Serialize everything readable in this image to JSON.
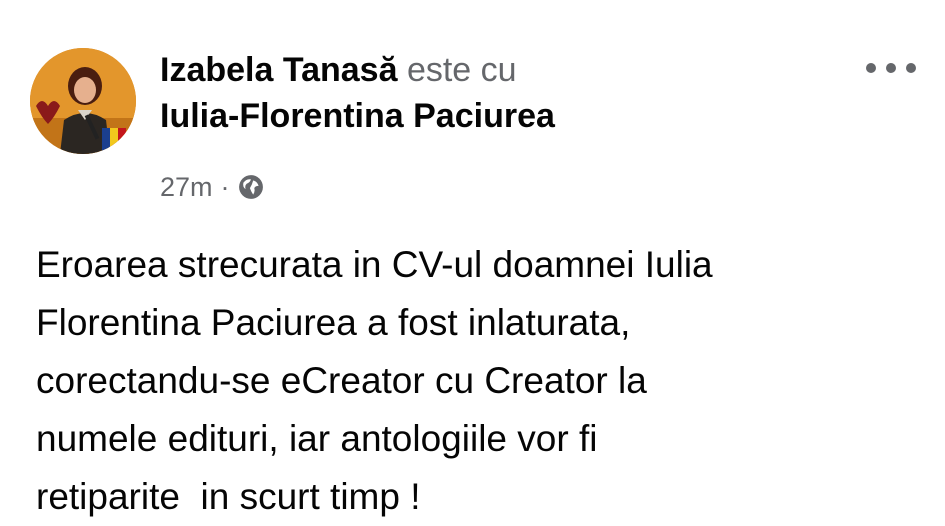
{
  "post": {
    "author": "Izabela Tanasă",
    "with_text": "este cu",
    "tagged": "Iulia-Florentina Paciurea",
    "time": "27m",
    "separator": "·",
    "audience_icon": "globe-icon",
    "more_icon": "more-options-icon",
    "body_lines": [
      "Eroarea strecurata in CV-ul doamnei Iulia",
      "Florentina Paciurea a fost inlaturata,",
      "corectandu-se eCreator cu Creator la",
      "numele edituri, iar antologiile vor fi",
      "retiparite  in scurt timp !"
    ]
  },
  "colors": {
    "text_primary": "#050505",
    "text_secondary": "#65676b",
    "avatar_background": "#e8a13a"
  }
}
